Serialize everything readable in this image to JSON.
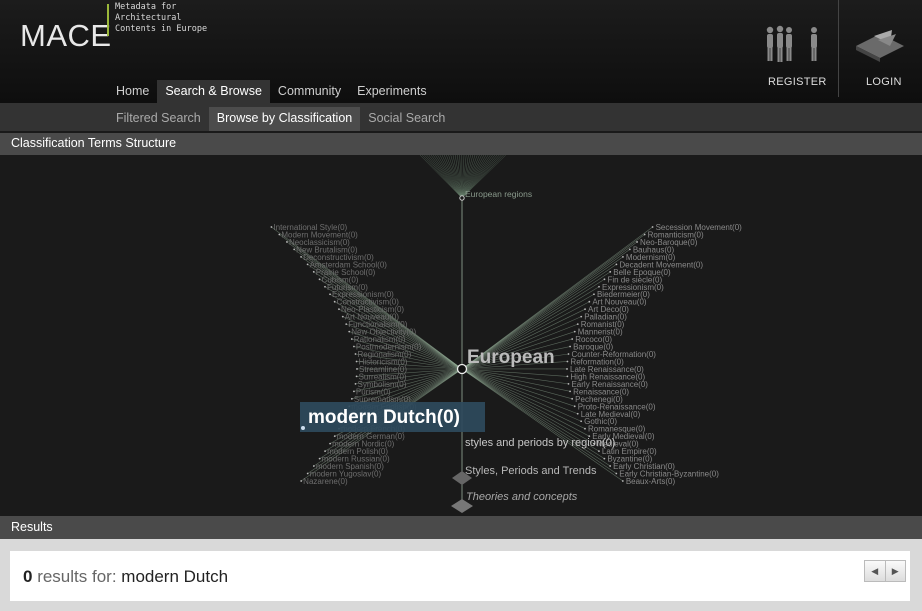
{
  "header": {
    "logo": "MACE",
    "tagline": "Metadata for Architectural Contents in Europe",
    "nav": [
      "Home",
      "Search & Browse",
      "Community",
      "Experiments"
    ],
    "nav_active": 1,
    "register_label": "REGISTER",
    "login_label": "LOGIN"
  },
  "subnav": {
    "tabs": [
      "Filtered Search",
      "Browse by Classification",
      "Social Search"
    ],
    "active": 1
  },
  "classification": {
    "title": "Classification Terms Structure",
    "top_node": "European regions",
    "center_node": "European",
    "selected_node": "modern Dutch(0)",
    "parent_node": "styles and periods by region(0)",
    "grandparent_node": "Styles, Periods and Trends",
    "root_node": "Theories and concepts",
    "left_terms": [
      "International Style(0)",
      "Modern Movement(0)",
      "Neoclassicism(0)",
      "New Brutalism(0)",
      "Deconstructivism(0)",
      "Amsterdam School(0)",
      "Prairie School(0)",
      "Cubism(0)",
      "Futurism(0)",
      "Expressionism(0)",
      "Constructivism(0)",
      "Neo-Plasticism(0)",
      "Art Nouveau(0)",
      "Functionalism(0)",
      "New Objectivity(0)",
      "Rationalism(0)",
      "Postmodernism(0)",
      "Regionalism(0)",
      "Historicism(0)",
      "Streamline(0)",
      "Surrealism(0)",
      "Symbolism(0)",
      "Purism(0)",
      "Suprematism(0)",
      "modern English(0)",
      "modern Italian(0)",
      "modern Dutch(0)",
      "modern French(0)",
      "modern German(0)",
      "modern Nordic(0)",
      "modern Polish(0)",
      "modern Russian(0)",
      "modern Spanish(0)",
      "modern Yugoslav(0)",
      "Nazarene(0)"
    ],
    "right_terms": [
      "Secession Movement(0)",
      "Romanticism(0)",
      "Neo-Baroque(0)",
      "Bauhaus(0)",
      "Modernism(0)",
      "Decadent Movement(0)",
      "Belle Epoque(0)",
      "Fin de siècle(0)",
      "Expressionism(0)",
      "Biedermeier(0)",
      "Art Nouveau(0)",
      "Art Deco(0)",
      "Palladian(0)",
      "Romanist(0)",
      "Mannerist(0)",
      "Rococo(0)",
      "Baroque(0)",
      "Counter-Reformation(0)",
      "Reformation(0)",
      "Late Renaissance(0)",
      "High Renaissance(0)",
      "Early Renaissance(0)",
      "Renaissance(0)",
      "Pechenegi(0)",
      "Proto-Renaissance(0)",
      "Late Medieval(0)",
      "Gothic(0)",
      "Romanesque(0)",
      "Early Medieval(0)",
      "Medieval(0)",
      "Latin Empire(0)",
      "Byzantine(0)",
      "Early Christian(0)",
      "Early Christian-Byzantine(0)",
      "Beaux-Arts(0)"
    ]
  },
  "results": {
    "title": "Results",
    "count": "0",
    "label": " results for: ",
    "query": "modern Dutch"
  },
  "colors": {
    "accent": "#9bb83a",
    "selected_bg": "#2e4a5c",
    "edge": "#8fa892"
  },
  "icons": [
    "people-icon",
    "person-icon",
    "login-arrow-icon",
    "prev-arrow-icon",
    "next-arrow-icon"
  ]
}
